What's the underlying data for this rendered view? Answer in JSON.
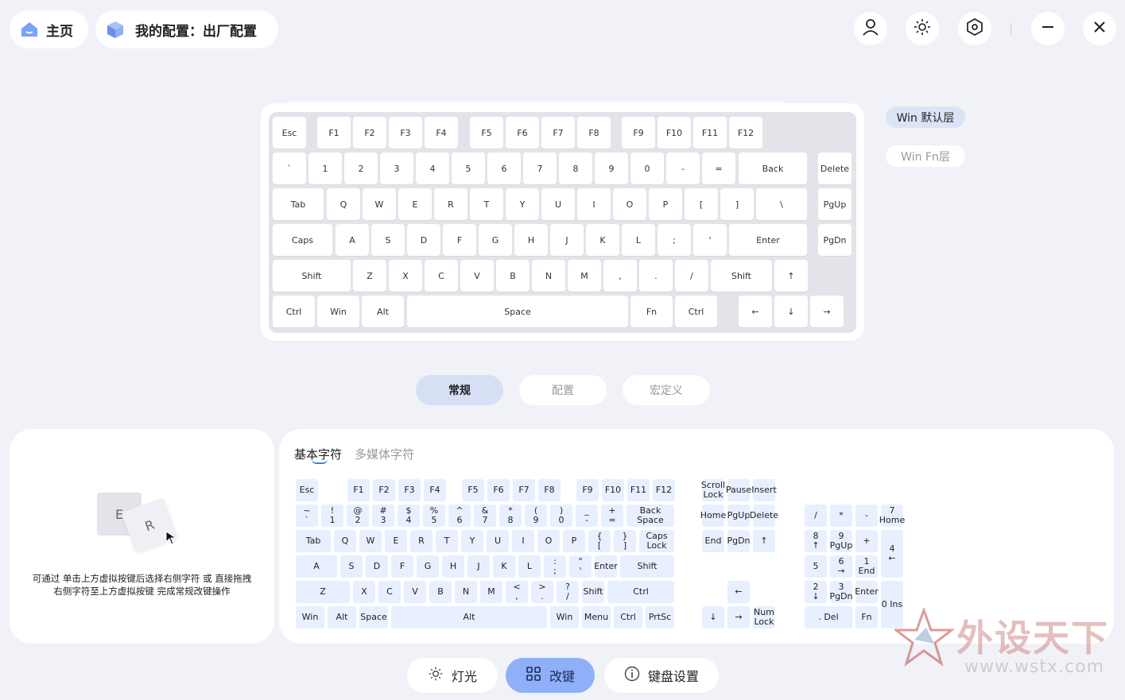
{
  "header": {
    "home_label": "主页",
    "config_label": "我的配置：出厂配置"
  },
  "layers": {
    "default": "Win 默认层",
    "fn": "Win Fn层"
  },
  "tabs": [
    {
      "label": "常规",
      "active": true
    },
    {
      "label": "配置",
      "active": false
    },
    {
      "label": "宏定义",
      "active": false
    }
  ],
  "keyboard": {
    "keys": [
      "Esc",
      "F1",
      "F2",
      "F3",
      "F4",
      "F5",
      "F6",
      "F7",
      "F8",
      "F9",
      "F10",
      "F11",
      "F12",
      "`",
      "1",
      "2",
      "3",
      "4",
      "5",
      "6",
      "7",
      "8",
      "9",
      "0",
      "-",
      "=",
      "Back",
      "Delete",
      "Tab",
      "Q",
      "W",
      "E",
      "R",
      "T",
      "Y",
      "U",
      "I",
      "O",
      "P",
      "[",
      "]",
      "\\",
      "PgUp",
      "Caps",
      "A",
      "S",
      "D",
      "F",
      "G",
      "H",
      "J",
      "K",
      "L",
      ";",
      "'",
      "Enter",
      "PgDn",
      "Shift",
      "Z",
      "X",
      "C",
      "V",
      "B",
      "N",
      "M",
      ",",
      ".",
      "/",
      "Shift",
      "↑",
      "Ctrl",
      "Win",
      "Alt",
      "Space",
      "Fn",
      "Ctrl",
      "←",
      "↓",
      "→"
    ]
  },
  "hint": {
    "key1": "E",
    "key2": "R",
    "line1": "可通过 单击上方虚拟按键后选择右侧字符 或 直接拖拽",
    "line2": "右侧字符至上方虚拟按键 完成常规改键操作"
  },
  "charset_tabs": [
    {
      "label": "基本字符",
      "active": true
    },
    {
      "label": "多媒体字符",
      "active": false
    }
  ],
  "charset_keys": [
    "Esc",
    "F1",
    "F2",
    "F3",
    "F4",
    "F5",
    "F6",
    "F7",
    "F8",
    "F9",
    "F10",
    "F11",
    "F12",
    "~\n`",
    "!\n1",
    "@\n2",
    "#\n3",
    "$\n4",
    "%\n5",
    "^\n6",
    "&\n7",
    "*\n8",
    "(\n9",
    ")\n0",
    "_\n-",
    "+\n=",
    "Back Space",
    "Tab",
    "Q",
    "W",
    "E",
    "R",
    "T",
    "Y",
    "U",
    "I",
    "O",
    "P",
    "{\n[",
    "}\n]",
    "|\n\\",
    "Caps Lock",
    "A",
    "S",
    "D",
    "F",
    "G",
    "H",
    "J",
    "K",
    "L",
    ":\n;",
    "\"\n'",
    "Enter",
    "Shift",
    "Z",
    "X",
    "C",
    "V",
    "B",
    "N",
    "M",
    "<\n,",
    ">\n.",
    "?\n/",
    "Shift",
    "Ctrl",
    "Win",
    "Alt",
    "Space",
    "Alt",
    "Win",
    "Menu",
    "Ctrl",
    "PrtSc",
    "Scroll\nLock",
    "Pause",
    "Insert",
    "Home",
    "PgUp",
    "Delete",
    "End",
    "PgDn",
    "↑",
    "←",
    "↓",
    "→",
    "Num\nLock",
    "/",
    "*",
    "-",
    "7\nHome",
    "8\n↑",
    "9\nPgUp",
    "+",
    "4\n←",
    "5",
    "6\n→",
    "1\nEnd",
    "2\n↓",
    "3\nPgDn",
    "Enter",
    "0 Ins",
    ". Del",
    "Fn"
  ],
  "bottom_nav": [
    {
      "label": "灯光",
      "active": false
    },
    {
      "label": "改键",
      "active": true
    },
    {
      "label": "键盘设置",
      "active": false
    }
  ],
  "watermark": {
    "text": "外设天下",
    "url": "www.wstx.com"
  }
}
